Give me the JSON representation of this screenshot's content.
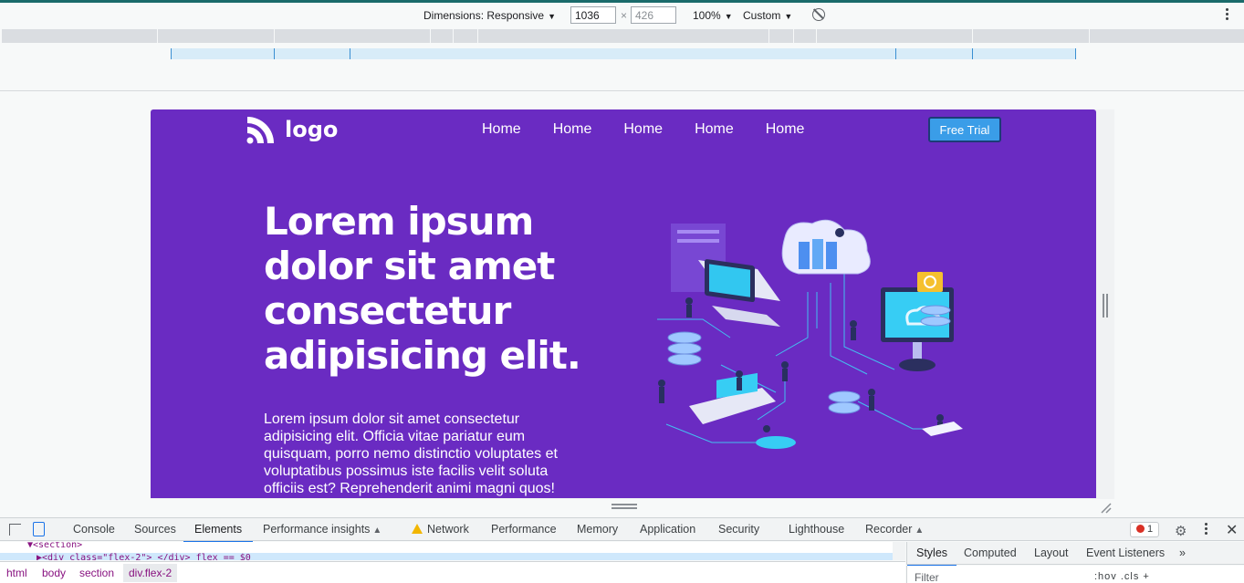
{
  "device_toolbar": {
    "dimensions_label": "Dimensions: Responsive",
    "width_value": "1036",
    "times": "×",
    "height_value": "426",
    "zoom": "100%",
    "throttle": "Custom"
  },
  "page": {
    "logo_text": "logo",
    "nav": [
      "Home",
      "Home",
      "Home",
      "Home",
      "Home"
    ],
    "cta_label": "Free Trial",
    "hero_title": "Lorem ipsum dolor sit amet consectetur adipisicing elit.",
    "hero_text": "Lorem ipsum dolor sit amet consectetur adipisicing elit. Officia vitae pariatur eum quisquam, porro nemo distinctio voluptates et voluptatibus possimus iste facilis velit soluta officiis est? Reprehenderit animi magni quos!",
    "colors": {
      "hero_bg": "#6a2bc2",
      "cta_bg": "#3a9de8",
      "cta_border": "#1d3b77"
    }
  },
  "devtools": {
    "tabs": [
      "Console",
      "Sources",
      "Elements",
      "Performance insights",
      "Network",
      "Performance",
      "Memory",
      "Application",
      "Security",
      "Lighthouse",
      "Recorder"
    ],
    "active_tab": "Elements",
    "error_count": "1",
    "dom_line_1": "▼<section>",
    "dom_line_2": "▶<div class=\"flex-2\"> </div> flex == $0",
    "breadcrumbs": [
      "html",
      "body",
      "section",
      "div.flex-2"
    ],
    "side_tabs": [
      "Styles",
      "Computed",
      "Layout",
      "Event Listeners"
    ],
    "active_side_tab": "Styles",
    "filter_placeholder": "Filter",
    "filter_tools": ":hov  .cls  +"
  }
}
